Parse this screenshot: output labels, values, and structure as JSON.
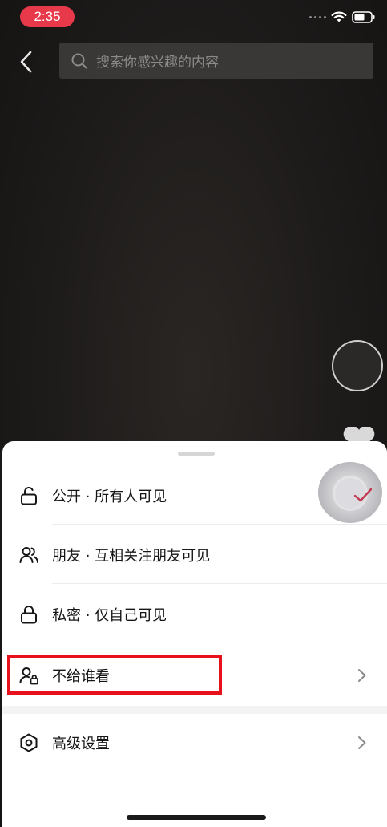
{
  "status_bar": {
    "time": "2:35"
  },
  "nav": {
    "search_placeholder": "搜索你感兴趣的内容"
  },
  "visibility_sheet": {
    "options": [
      {
        "label": "公开 · 所有人可见",
        "icon": "unlock-icon",
        "selected": true
      },
      {
        "label": "朋友 · 互相关注朋友可见",
        "icon": "friends-icon",
        "selected": false
      },
      {
        "label": "私密 · 仅自己可见",
        "icon": "lock-icon",
        "selected": false
      },
      {
        "label": "不给谁看",
        "icon": "user-lock-icon",
        "has_chevron": true,
        "highlighted": true
      }
    ],
    "advanced": {
      "label": "高级设置",
      "icon": "hexagon-settings-icon",
      "has_chevron": true
    }
  },
  "colors": {
    "status_time_bg": "#e8394a",
    "check_accent": "#c2374f",
    "highlight_border": "#e8111b"
  }
}
